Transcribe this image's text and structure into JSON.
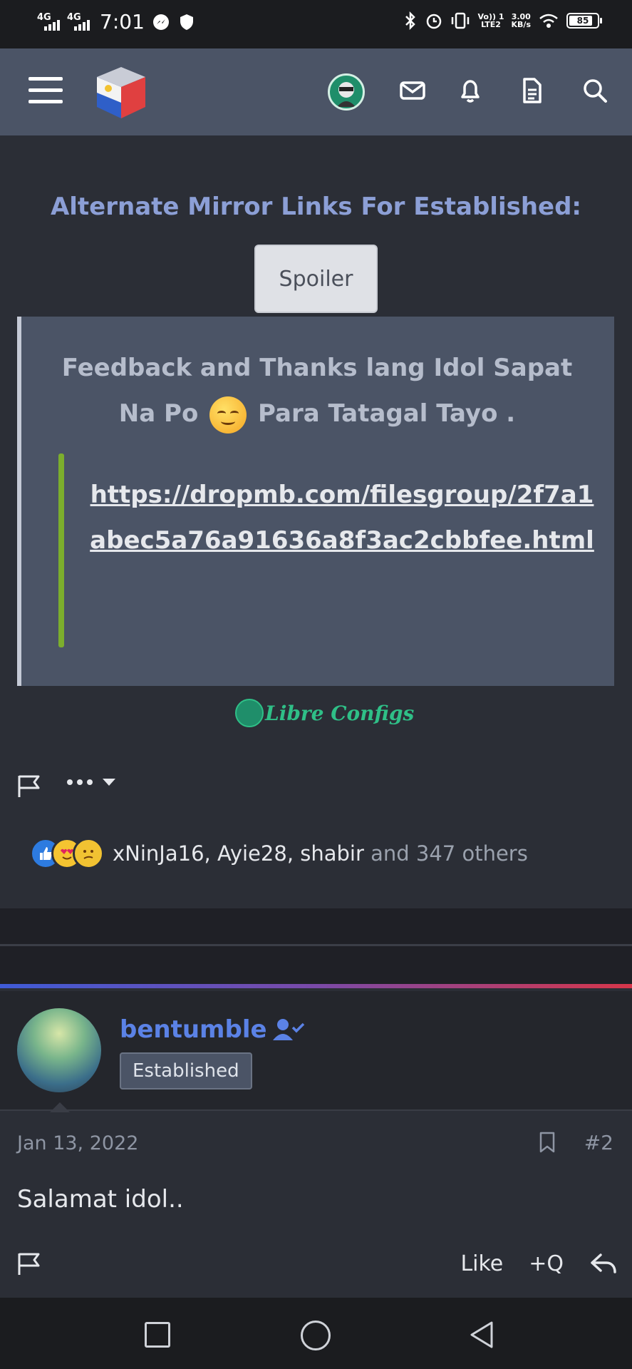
{
  "status_bar": {
    "signal1": "4G",
    "signal2": "4G",
    "time": "7:01",
    "volte": "Vo)) 1",
    "lte": "LTE2",
    "speed": "3.00",
    "speed_unit": "KB/s",
    "battery": "85"
  },
  "header": {
    "icons": [
      "menu-icon",
      "site-logo",
      "user-avatar",
      "mail-icon",
      "bell-icon",
      "document-icon",
      "search-icon"
    ]
  },
  "post1": {
    "mirror_title": "Alternate Mirror Links For Established:",
    "spoiler_label": "Spoiler",
    "spoiler_text_1": "Feedback and Thanks lang Idol Sapat Na Po",
    "spoiler_text_2": "Para Tatagal Tayo .",
    "link": "https://dropmb.com/filesgroup/2f7a1abec5a76a91636a8f3ac2cbbfee.html",
    "signature": "Libre Configs",
    "reactions": {
      "users": [
        "xNinJa16",
        "Ayie28",
        "shabir"
      ],
      "sep": ", ",
      "others": " and 347 others"
    }
  },
  "post2": {
    "username": "bentumble",
    "badge": "Established",
    "date": "Jan 13, 2022",
    "number": "#2",
    "body": "Salamat idol..",
    "like_label": "Like",
    "quote_label": "+Q"
  },
  "colors": {
    "accent_blue": "#5b82e6",
    "link_green_bar": "#7cae2d",
    "title_blue": "#8c9fd6"
  }
}
